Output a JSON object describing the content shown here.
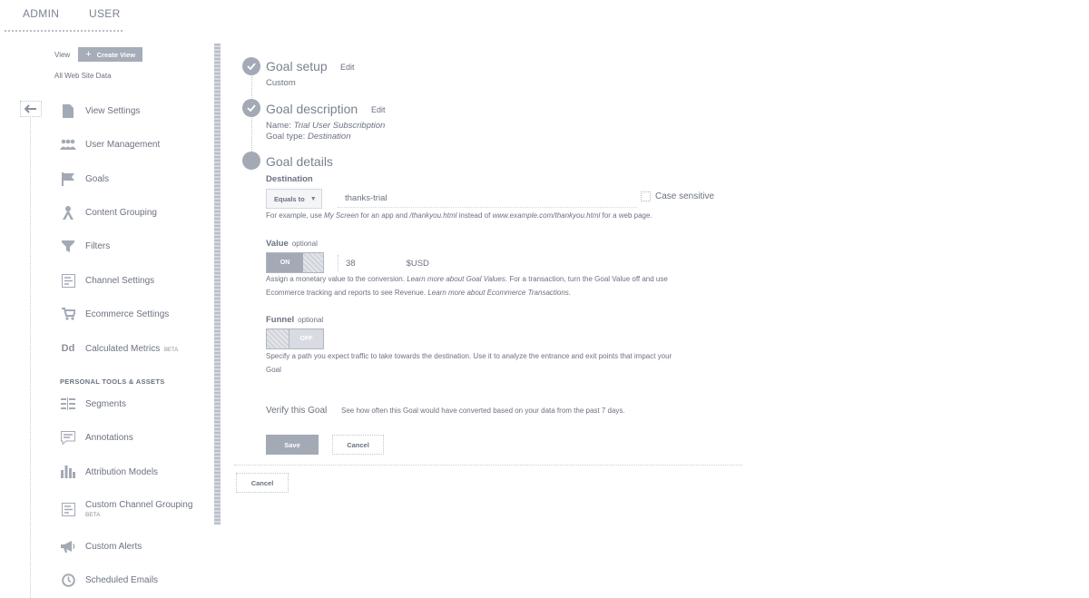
{
  "topnav": {
    "admin": "ADMIN",
    "user": "USER"
  },
  "sidebar": {
    "view_label": "View",
    "create_view": "Create View",
    "site_data": "All Web Site Data",
    "items": [
      {
        "label": "View Settings",
        "icon": "document-icon"
      },
      {
        "label": "User Management",
        "icon": "users-icon"
      },
      {
        "label": "Goals",
        "icon": "flag-icon"
      },
      {
        "label": "Content Grouping",
        "icon": "content-grouping-icon"
      },
      {
        "label": "Filters",
        "icon": "filter-icon"
      },
      {
        "label": "Channel Settings",
        "icon": "channel-icon"
      },
      {
        "label": "Ecommerce Settings",
        "icon": "cart-icon"
      },
      {
        "label": "Calculated Metrics",
        "beta": "BETA",
        "icon": "calculated-metrics-icon",
        "icon_text": "Dd"
      }
    ],
    "section_title": "PERSONAL TOOLS & ASSETS",
    "tools": [
      {
        "label": "Segments",
        "icon": "segments-icon"
      },
      {
        "label": "Annotations",
        "icon": "annotations-icon"
      },
      {
        "label": "Attribution Models",
        "icon": "bar-chart-icon"
      },
      {
        "label": "Custom Channel Grouping",
        "beta": "BETA",
        "icon": "channel-grouping-icon"
      },
      {
        "label": "Custom Alerts",
        "icon": "megaphone-icon"
      },
      {
        "label": "Scheduled Emails",
        "icon": "clock-icon"
      }
    ]
  },
  "goal": {
    "setup": {
      "title": "Goal setup",
      "edit": "Edit",
      "value": "Custom"
    },
    "description": {
      "title": "Goal description",
      "edit": "Edit",
      "name_label": "Name:",
      "name_value": "Trial User Subscribption",
      "type_label": "Goal type:",
      "type_value": "Destination"
    },
    "details": {
      "title": "Goal details",
      "destination_label": "Destination",
      "match_type": "Equals to",
      "destination_value": "thanks-trial",
      "case_sensitive": "Case sensitive",
      "helper_1": "For example, use",
      "helper_2": "My Screen",
      "helper_3": "for an app and",
      "helper_4": "/thankyou.html",
      "helper_5": "instead of",
      "helper_6": "www.example.com/thankyou.html",
      "helper_7": "for a web page.",
      "value_label": "Value",
      "value_optional": "optional",
      "value_toggle": "ON",
      "value_amount": "38",
      "value_currency": "$USD",
      "value_help_1": "Assign a monetary value to the conversion.",
      "value_help_2": "Learn more about Goal Values",
      "value_help_3": ". For a transaction, turn the Goal Value off and use",
      "value_help_4": "Ecommerce tracking and reports to see Revenue.",
      "value_help_5": "Learn more about Ecommerce Transactions.",
      "funnel_label": "Funnel",
      "funnel_optional": "optional",
      "funnel_toggle": "OFF",
      "funnel_help_1": "Specify a path you expect traffic to take towards the destination. Use it to analyze the entrance and exit points that impact your",
      "funnel_help_2": "Goal"
    },
    "verify_label": "Verify this Goal",
    "verify_text": "See how often this Goal would have converted based on your data from the past 7 days.",
    "save": "Save",
    "cancel": "Cancel",
    "cancel_outer": "Cancel"
  },
  "colors": {
    "accent": "#a3a9b5",
    "text": "#6b7280"
  }
}
